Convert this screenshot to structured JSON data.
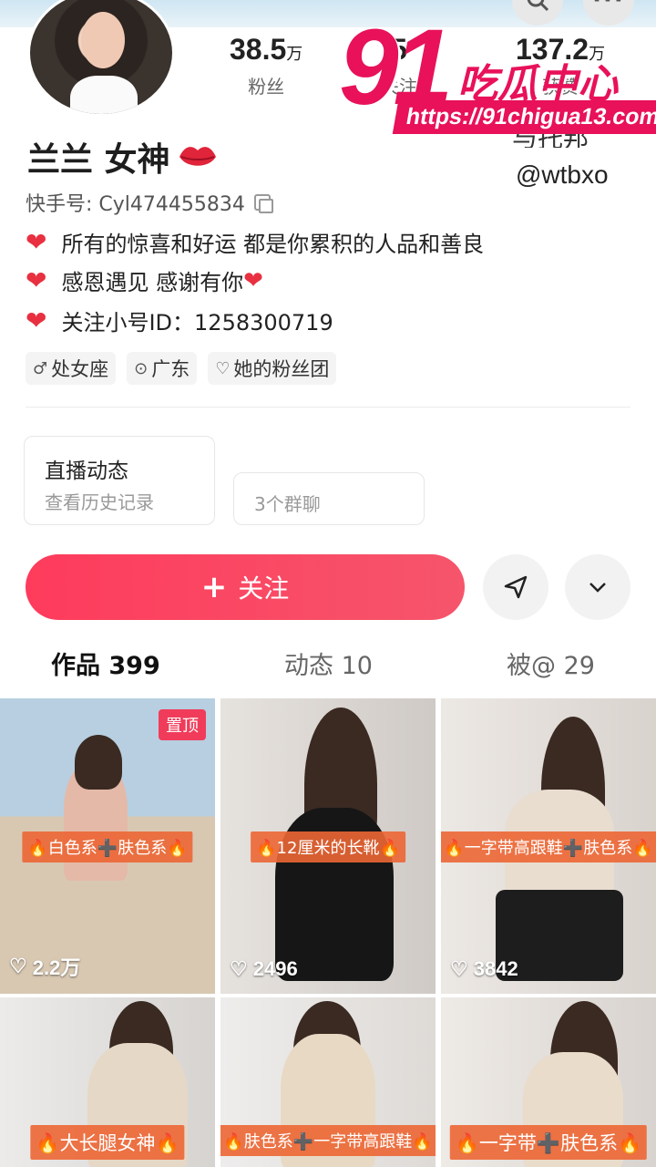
{
  "header": {
    "search_icon": "search-icon",
    "more_icon": "more-icon"
  },
  "profile": {
    "name": "兰兰 女神",
    "kuaishou_id": "快手号: Cyl474455834",
    "stats": [
      {
        "value": "38.5",
        "unit": "万",
        "label": "粉丝"
      },
      {
        "value": "5",
        "unit": "",
        "label": "关注"
      },
      {
        "value": "137.2",
        "unit": "万",
        "label": "获赞"
      }
    ],
    "bio": [
      {
        "text": "所有的惊喜和好运 都是你累积的人品和善良"
      },
      {
        "text": "感恩遇见 感谢有你",
        "trailing_heart": "❤"
      },
      {
        "text": "关注小号ID：1258300719"
      }
    ],
    "tags": [
      {
        "icon": "♂",
        "label": "处女座"
      },
      {
        "icon": "⊙",
        "label": "广东"
      },
      {
        "icon": "♡",
        "label": "她的粉丝团"
      }
    ]
  },
  "watermark": {
    "number": "91",
    "title": "吃瓜中心",
    "url": "https://91chigua13.com",
    "partial_text": "与托邦",
    "handle": "@wtbxo"
  },
  "cards": {
    "live_title": "直播动态",
    "live_sub": "查看历史记录",
    "group_sub": "3个群聊"
  },
  "actions": {
    "follow_label": "关注",
    "follow_icon": "+"
  },
  "tabs": [
    {
      "label": "作品 399"
    },
    {
      "label": "动态 10"
    },
    {
      "label": "被@ 29"
    }
  ],
  "posts": [
    {
      "caption": "🔥白色系➕肤色系🔥",
      "likes": "2.2万",
      "pinned": "置顶"
    },
    {
      "caption": "🔥12厘米的长靴🔥",
      "likes": "2496"
    },
    {
      "caption": "🔥一字带高跟鞋➕肤色系🔥",
      "likes": "3842"
    },
    {
      "caption": "🔥大长腿女神🔥"
    },
    {
      "caption": "🔥肤色系➕一字带高跟鞋🔥"
    },
    {
      "caption": "🔥一字带➕肤色系🔥"
    }
  ],
  "colors": {
    "accent": "#fe3b5c",
    "watermark": "#e8115a",
    "caption_bg": "#ec6634"
  }
}
